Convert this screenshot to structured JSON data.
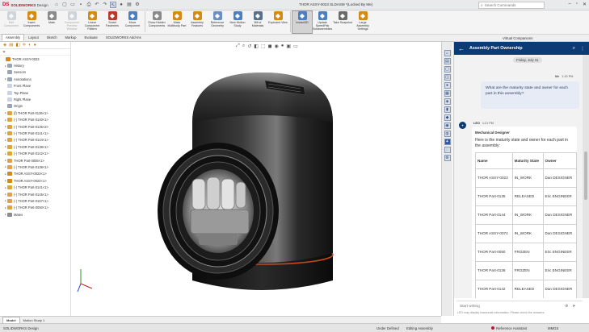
{
  "app": {
    "brand": "SOLIDWORKS",
    "brand_suffix": "Design",
    "doc_title": "THOR ASSY-0023 SLDASM *(Locked By Me)",
    "search_placeholder": "Search Commands"
  },
  "ribbon": {
    "buttons": [
      {
        "label": "Edit Component",
        "icon": "edit-component-icon",
        "color": "#9aa5b5",
        "disabled": true
      },
      {
        "label": "Insert Components",
        "icon": "insert-components-icon",
        "color": "#d48a14"
      },
      {
        "label": "Mate",
        "icon": "mate-icon",
        "color": "#8a8a8a"
      },
      {
        "label": "Component Preview Window",
        "icon": "preview-window-icon",
        "color": "#9aa5b5",
        "disabled": true
      },
      {
        "label": "Linear Component Pattern",
        "icon": "pattern-icon",
        "color": "#d48a14"
      },
      {
        "label": "Smart Fasteners",
        "icon": "fastener-icon",
        "color": "#b53a2a"
      },
      {
        "label": "Move Component",
        "icon": "move-component-icon",
        "color": "#4a7fc0"
      },
      {
        "label": "Show Hidden Components",
        "icon": "show-hidden-icon",
        "color": "#8a8a8a"
      },
      {
        "label": "Make Multibody Part",
        "icon": "multibody-icon",
        "color": "#d48a14"
      },
      {
        "label": "Assembly Features",
        "icon": "assembly-features-icon",
        "color": "#d48a14"
      },
      {
        "label": "Reference Geometry",
        "icon": "reference-geometry-icon",
        "color": "#6a8fc7"
      },
      {
        "label": "New Motion Study",
        "icon": "motion-study-icon",
        "color": "#4a7fc0"
      },
      {
        "label": "Bill of Materials",
        "icon": "bom-icon",
        "color": "#5a6f8a"
      },
      {
        "label": "Exploded View",
        "icon": "exploded-view-icon",
        "color": "#d48a14"
      },
      {
        "label": "Instant3D",
        "icon": "instant3d-icon",
        "color": "#4a7fc0",
        "pressed": true
      },
      {
        "label": "Update SpeedPak Subassemblies",
        "icon": "speedpak-icon",
        "color": "#4a7fc0"
      },
      {
        "label": "Take Snapshot",
        "icon": "snapshot-icon",
        "color": "#6a6a6a"
      },
      {
        "label": "Large Assembly Settings",
        "icon": "large-assembly-icon",
        "color": "#d48a14"
      }
    ]
  },
  "tabs": [
    "Assembly",
    "Layout",
    "Sketch",
    "Markup",
    "Evaluate",
    "SOLIDWORKS Add-Ins"
  ],
  "active_tab": "Assembly",
  "virtual_companions": "Virtual Companions",
  "tree": {
    "items": [
      {
        "label": "THOR ASSY-0023",
        "indent": 0,
        "icon_color": "#d48a14",
        "expand": ""
      },
      {
        "label": "History",
        "indent": 1,
        "icon_color": "#9aa5b5",
        "expand": "▸"
      },
      {
        "label": "Sensors",
        "indent": 1,
        "icon_color": "#9aa5b5",
        "expand": ""
      },
      {
        "label": "Annotations",
        "indent": 1,
        "icon_color": "#9aa5b5",
        "expand": "▸"
      },
      {
        "label": "Front Plane",
        "indent": 1,
        "icon_color": "#c9d3e3",
        "expand": ""
      },
      {
        "label": "Top Plane",
        "indent": 1,
        "icon_color": "#c9d3e3",
        "expand": ""
      },
      {
        "label": "Right Plane",
        "indent": 1,
        "icon_color": "#c9d3e3",
        "expand": ""
      },
      {
        "label": "Origin",
        "indent": 1,
        "icon_color": "#9aa5b5",
        "expand": ""
      },
      {
        "label": "(f) THOR Part-0136<1>",
        "indent": 1,
        "icon_color": "#e0a43a",
        "expand": "▸"
      },
      {
        "label": "(-) THOR Part-0140<1>",
        "indent": 1,
        "icon_color": "#e0a43a",
        "expand": "▸"
      },
      {
        "label": "(-) THOR Part-0135<2>",
        "indent": 1,
        "icon_color": "#e0a43a",
        "expand": "▸"
      },
      {
        "label": "(-) THOR Part-0141<1>",
        "indent": 1,
        "icon_color": "#e0a43a",
        "expand": "▸"
      },
      {
        "label": "(-) THOR Part-0144<1>",
        "indent": 1,
        "icon_color": "#e0a43a",
        "expand": "▸"
      },
      {
        "label": "(-) THOR Part-0138<1>",
        "indent": 1,
        "icon_color": "#e0a43a",
        "expand": "▸"
      },
      {
        "label": "(-) THOR Part-0142<1>",
        "indent": 1,
        "icon_color": "#e0a43a",
        "expand": "▸"
      },
      {
        "label": "THOR Part-0005<1>",
        "indent": 1,
        "icon_color": "#e0a43a",
        "expand": "▸"
      },
      {
        "label": "(-) THOR Part-0139<1>",
        "indent": 1,
        "icon_color": "#e0a43a",
        "expand": "▸"
      },
      {
        "label": "THOR ASSY-0023<1>",
        "indent": 1,
        "icon_color": "#d48a14",
        "expand": "▸"
      },
      {
        "label": "THOR ASSY-0024<1>",
        "indent": 1,
        "icon_color": "#d48a14",
        "expand": "▸"
      },
      {
        "label": "(-) THOR Part-0141<1>",
        "indent": 1,
        "icon_color": "#e0a43a",
        "expand": "▸"
      },
      {
        "label": "(-) THOR Part-0145<1>",
        "indent": 1,
        "icon_color": "#e0a43a",
        "expand": "▸"
      },
      {
        "label": "(-) THOR Part-0167<1>",
        "indent": 1,
        "icon_color": "#e0a43a",
        "expand": "▸"
      },
      {
        "label": "(-) THOR Part-0050<1>",
        "indent": 1,
        "icon_color": "#e0a43a",
        "expand": "▸"
      },
      {
        "label": "Mates",
        "indent": 1,
        "icon_color": "#8a8a8a",
        "expand": "▸"
      }
    ]
  },
  "chat": {
    "title": "Assembly Part Ownership",
    "date": "Friday, July 31",
    "me_name": "Me",
    "me_time": "1:20 PM",
    "me_message": "What are the maturity state and owner for each part in this assembly?",
    "bot_name": "LEO",
    "bot_time": "1:21 PM",
    "bot_role": "Mechanical Designer",
    "bot_intro": "Here is the maturity state and owner for each part in the assembly:",
    "table_headers": [
      "Name",
      "Maturity State",
      "Owner"
    ],
    "table_rows": [
      [
        "THOR ASSY-0023",
        "IN_WORK",
        "Dan DESIGNER"
      ],
      [
        "THOR Part-0135",
        "RELEASED",
        "Eric ENGINEER"
      ],
      [
        "THOR Part-0144",
        "IN_WORK",
        "Dan DESIGNER"
      ],
      [
        "THOR ASSY-0074",
        "IN_WORK",
        "Dan DESIGNER"
      ],
      [
        "THOR Part-0050",
        "FROZEN",
        "Eric ENGINEER"
      ],
      [
        "THOR Part-0138",
        "FROZEN",
        "Eric ENGINEER"
      ],
      [
        "THOR Part-0142",
        "RELEASED",
        "Dan DESIGNER"
      ]
    ],
    "input_placeholder": "Start writing",
    "disclaimer": "LEO may display inaccurate information. Please check the answers."
  },
  "bottom_tabs": [
    "Model",
    "Motion Study 1"
  ],
  "status": {
    "app": "SOLIDWORKS Design",
    "definition": "Under Defined",
    "editing": "Editing Assembly",
    "assistant": "Reference Assistant",
    "units": "MMGS"
  }
}
